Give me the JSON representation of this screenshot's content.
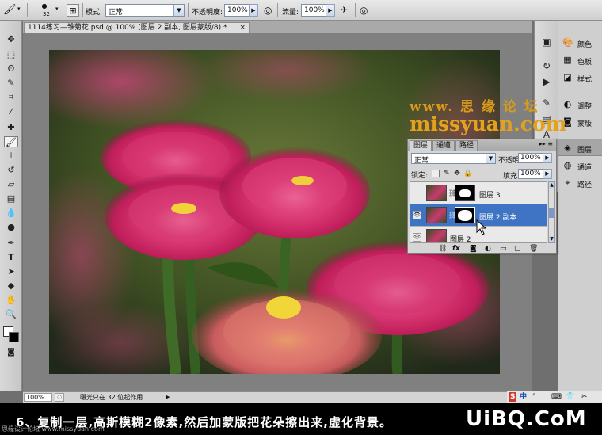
{
  "options_bar": {
    "brush_size": "32",
    "mode_label": "模式:",
    "mode_value": "正常",
    "opacity_label": "不透明度:",
    "opacity_value": "100%",
    "flow_label": "流量:",
    "flow_value": "100%"
  },
  "document": {
    "tab_title": "1114练习—雏菊花.psd @ 100% (图层 2 副本, 图层蒙版/8) *",
    "close_symbol": "×"
  },
  "status_bar": {
    "zoom": "100%",
    "info": "曝光只在 32 位起作用"
  },
  "dock_panels": [
    {
      "label": "颜色",
      "icon": "palette-icon"
    },
    {
      "label": "色板",
      "icon": "swatches-icon"
    },
    {
      "label": "样式",
      "icon": "styles-icon"
    },
    {
      "label": "调整",
      "icon": "adjust-icon"
    },
    {
      "label": "蒙版",
      "icon": "mask-icon"
    },
    {
      "label": "图层",
      "icon": "layers-icon"
    },
    {
      "label": "通道",
      "icon": "channels-icon"
    },
    {
      "label": "路径",
      "icon": "paths-icon"
    }
  ],
  "watermark": {
    "line1": "www. 思 缘 论 坛",
    "line2": "missyuan.com"
  },
  "layers_panel": {
    "tabs": [
      "图层",
      "通道",
      "路径"
    ],
    "blend_mode": "正常",
    "opacity_label": "不透明度:",
    "opacity_value": "100%",
    "lock_label": "锁定:",
    "fill_label": "填充:",
    "fill_value": "100%",
    "layers": [
      {
        "name": "图层 3",
        "visible": false,
        "selected": false
      },
      {
        "name": "图层 2 副本",
        "visible": true,
        "selected": true
      },
      {
        "name": "图层 2",
        "visible": true,
        "selected": false
      }
    ]
  },
  "caption": {
    "text": "6、复制一层,高斯模糊2像素,然后加蒙版把花朵擦出来,虚化背景。",
    "small": "思缘设计论坛 www.missyuan.com",
    "logo": "UiBQ.CoM"
  },
  "taskbar": {
    "items": [
      "S",
      "中",
      "°",
      ",",
      "⌨",
      "👕",
      "✂"
    ]
  },
  "colors": {
    "selected_layer": "#3f73c4",
    "watermark": "#e4a21c"
  }
}
